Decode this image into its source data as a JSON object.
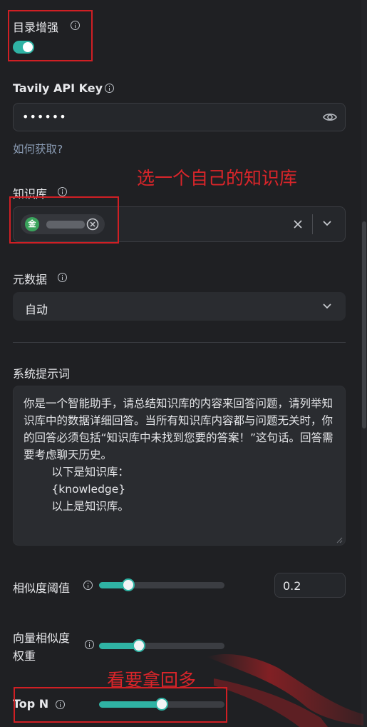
{
  "toc_enhance": {
    "label": "目录增强",
    "enabled": true
  },
  "tavily": {
    "label": "Tavily API Key",
    "value": "••••••",
    "help_link": "如何获取?"
  },
  "knowledge_base": {
    "label": "知识库",
    "tag_icon_text": "金",
    "annotation": "选一个自己的知识库"
  },
  "metadata": {
    "label": "元数据",
    "selected": "自动"
  },
  "system_prompt": {
    "label": "系统提示词",
    "text": "你是一个智能助手，请总结知识库的内容来回答问题，请列举知识库中的数据详细回答。当所有知识库内容都与问题无关时，你的回答必须包括“知识库中未找到您要的答案！”这句话。回答需要考虑聊天历史。\n        以下是知识库：\n        {knowledge}\n        以上是知识库。"
  },
  "similarity_threshold": {
    "label": "相似度阈值",
    "value": "0.2",
    "level": 0.2
  },
  "vector_weight": {
    "label_line1": "向量相似度",
    "label_line2": "权重",
    "level": 0.3
  },
  "top_n": {
    "label": "Top N",
    "level": 0.5,
    "annotation": "看要拿回多"
  },
  "colors": {
    "accent": "#2fb3a4",
    "annotation_red": "#d01f24",
    "background": "#1f2023"
  }
}
